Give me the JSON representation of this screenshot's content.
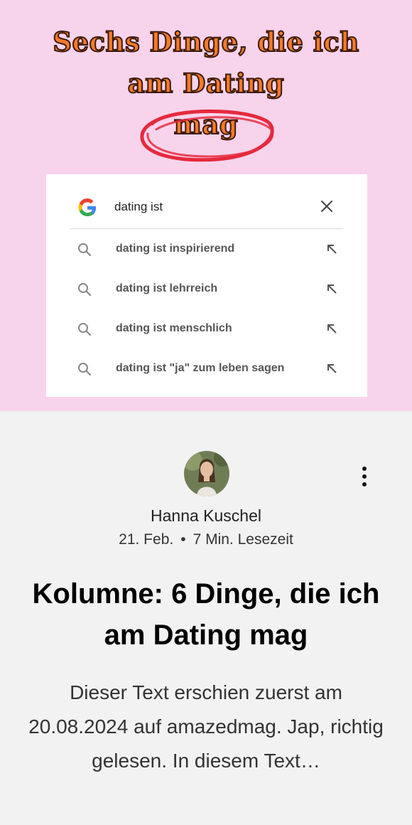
{
  "hero": {
    "title_lines": [
      "Sechs Dinge, die ich",
      "am Dating",
      "mag"
    ],
    "title_color": "#f47a2a",
    "background": "#f8d3ec",
    "circle_color": "#e52a3d",
    "search": {
      "query": "dating ist",
      "logo": "google-g-icon",
      "suggestions": [
        "dating ist inspirierend",
        "dating ist lehrreich",
        "dating ist menschlich",
        "dating ist \"ja\" zum leben sagen"
      ]
    }
  },
  "post": {
    "author": "Hanna Kuschel",
    "date": "21. Feb.",
    "separator": "•",
    "read_time": "7 Min. Lesezeit",
    "title": "Kolumne: 6 Dinge, die ich am Dating mag",
    "excerpt": "Dieser Text erschien zuerst am 20.08.2024 auf amazedmag. Jap, richtig gelesen. In diesem Text…"
  }
}
